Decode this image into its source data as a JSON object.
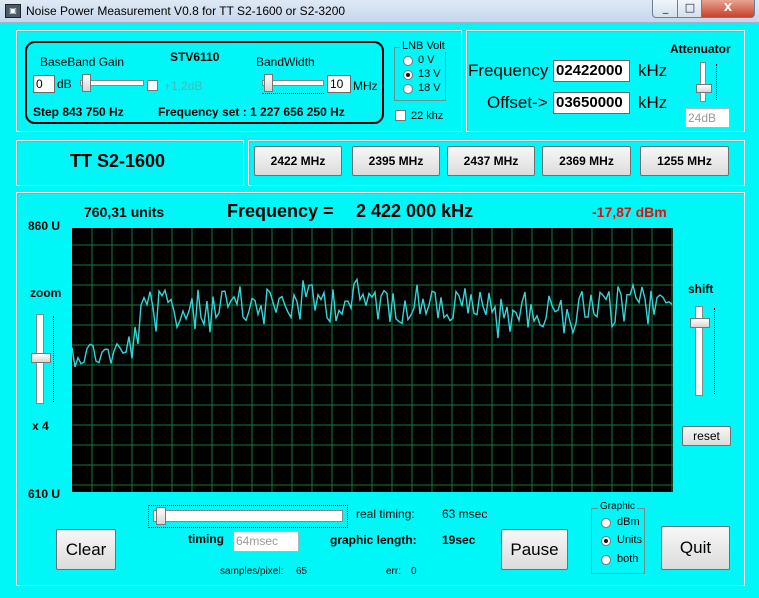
{
  "window": {
    "title": "Noise Power Measurement V0.8 for TT S2-1600 or S2-3200",
    "minimize": "_",
    "maximize": "□",
    "close": "X"
  },
  "tuner": {
    "baseband_gain_label": "BaseBand Gain",
    "chip_label": "STV6110",
    "bandwidth_label": "BandWidth",
    "gain_value": "0",
    "gain_unit": "dB",
    "gain_extra": "+1,2dB",
    "bandwidth_value": "10",
    "bandwidth_unit": "MHz",
    "step_text": "Step  843 750 Hz",
    "freq_set_text": "Frequency set : 1 227 656 250 Hz"
  },
  "lnb": {
    "title": "LNB Volt",
    "options": [
      "0 V",
      "13 V",
      "18 V"
    ],
    "selected": "13 V",
    "khz22_label": "22 khz"
  },
  "frequency": {
    "freq_label": "Frequency",
    "freq_value": "02422000",
    "freq_unit": "kHz",
    "offset_label": "Offset->",
    "offset_value": "03650000",
    "offset_unit": "kHz",
    "attenuator_label": "Attenuator",
    "attenuator_value": "24dB"
  },
  "device_name": "TT S2-1600",
  "presets": [
    "2422 MHz",
    "2395 MHz",
    "2437 MHz",
    "2369 MHz",
    "1255 MHz"
  ],
  "readout": {
    "units": "760,31 units",
    "frequency_label": "Frequency =",
    "frequency_value": "2 422 000 kHz",
    "dbm": "-17,87 dBm",
    "y_top": "860 U",
    "y_bottom": "610 U",
    "zoom_label": "zoom",
    "zoom_value": "x 4",
    "shift_label": "shift",
    "reset_label": "reset"
  },
  "bottom": {
    "real_timing_label": "real timing:",
    "real_timing_value": "63 msec",
    "timing_label": "timing",
    "timing_value": "64msec",
    "graphic_length_label": "graphic length:",
    "graphic_length_value": "19sec",
    "samples_label": "samples/pixel:",
    "samples_value": "65",
    "err_label": "err:",
    "err_value": "0",
    "clear_label": "Clear",
    "pause_label": "Pause",
    "quit_label": "Quit",
    "graphic_title": "Graphic",
    "graphic_options": [
      "dBm",
      "Units",
      "both"
    ],
    "graphic_selected": "Units"
  },
  "colors": {
    "window_bg": "#00f7f7",
    "trace": "#33d6d6",
    "grid": "#0f7a45",
    "dbm_text": "#e01010"
  }
}
